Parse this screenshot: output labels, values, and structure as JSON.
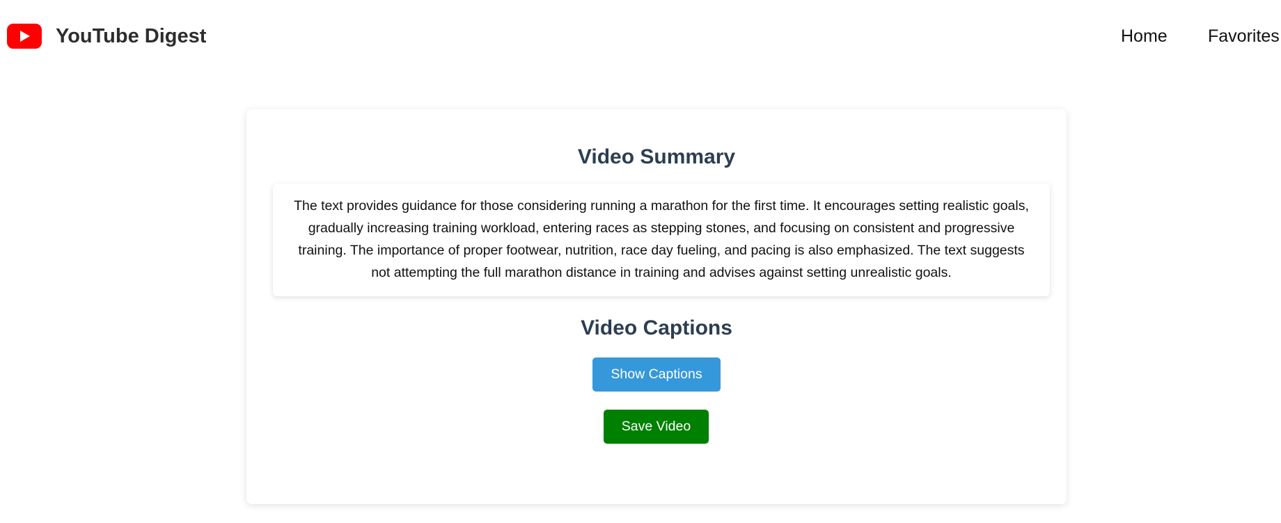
{
  "header": {
    "logo_icon": "youtube-play-icon",
    "logo_color": "#ff0000",
    "title": "YouTube Digest",
    "nav": [
      {
        "label": "Home"
      },
      {
        "label": "Favorites"
      }
    ]
  },
  "summary": {
    "title": "Video Summary",
    "text": "The text provides guidance for those considering running a marathon for the first time. It encourages setting realistic goals, gradually increasing training workload, entering races as stepping stones, and focusing on consistent and progressive training. The importance of proper footwear, nutrition, race day fueling, and pacing is also emphasized. The text suggests not attempting the full marathon distance in training and advises against setting unrealistic goals."
  },
  "captions": {
    "title": "Video Captions",
    "show_label": "Show Captions",
    "show_color": "#3498db"
  },
  "actions": {
    "save_label": "Save Video",
    "save_color": "#008000"
  }
}
